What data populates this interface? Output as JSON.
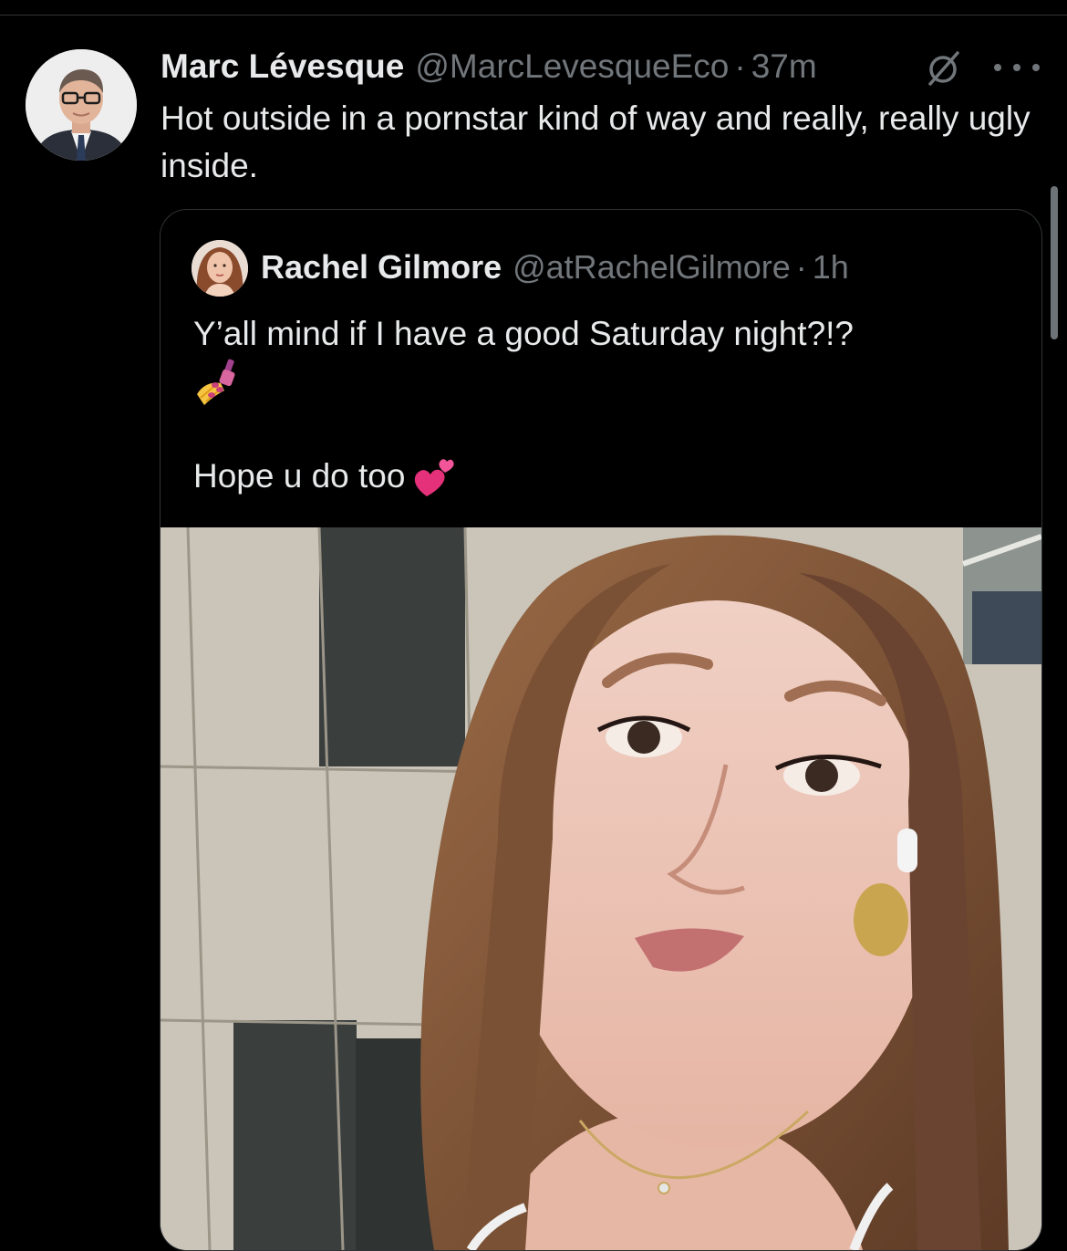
{
  "tweet": {
    "author": {
      "display_name": "Marc Lévesque",
      "handle": "@MarcLevesqueEco",
      "avatar_icon": "profile-photo-man-in-suit"
    },
    "separator": "·",
    "time": "37m",
    "edited_icon": "edit-history-icon",
    "more_icon": "more-options-icon",
    "text": "Hot outside in a pornstar kind of way and really, really ugly inside."
  },
  "quoted_tweet": {
    "author": {
      "display_name": "Rachel Gilmore",
      "handle": "@atRachelGilmore",
      "avatar_icon": "profile-photo-woman"
    },
    "separator": "·",
    "time": "1h",
    "text_line_1": "Y’all mind if I have a good Saturday night?!?",
    "emoji_1": "nail-polish-emoji",
    "text_line_2": "Hope u do too",
    "emoji_2": "two-hearts-emoji",
    "media": "selfie-photo"
  },
  "colors": {
    "background": "#000000",
    "primary_text": "#e7e9ea",
    "secondary_text": "#71767b",
    "border": "#2f3336"
  }
}
